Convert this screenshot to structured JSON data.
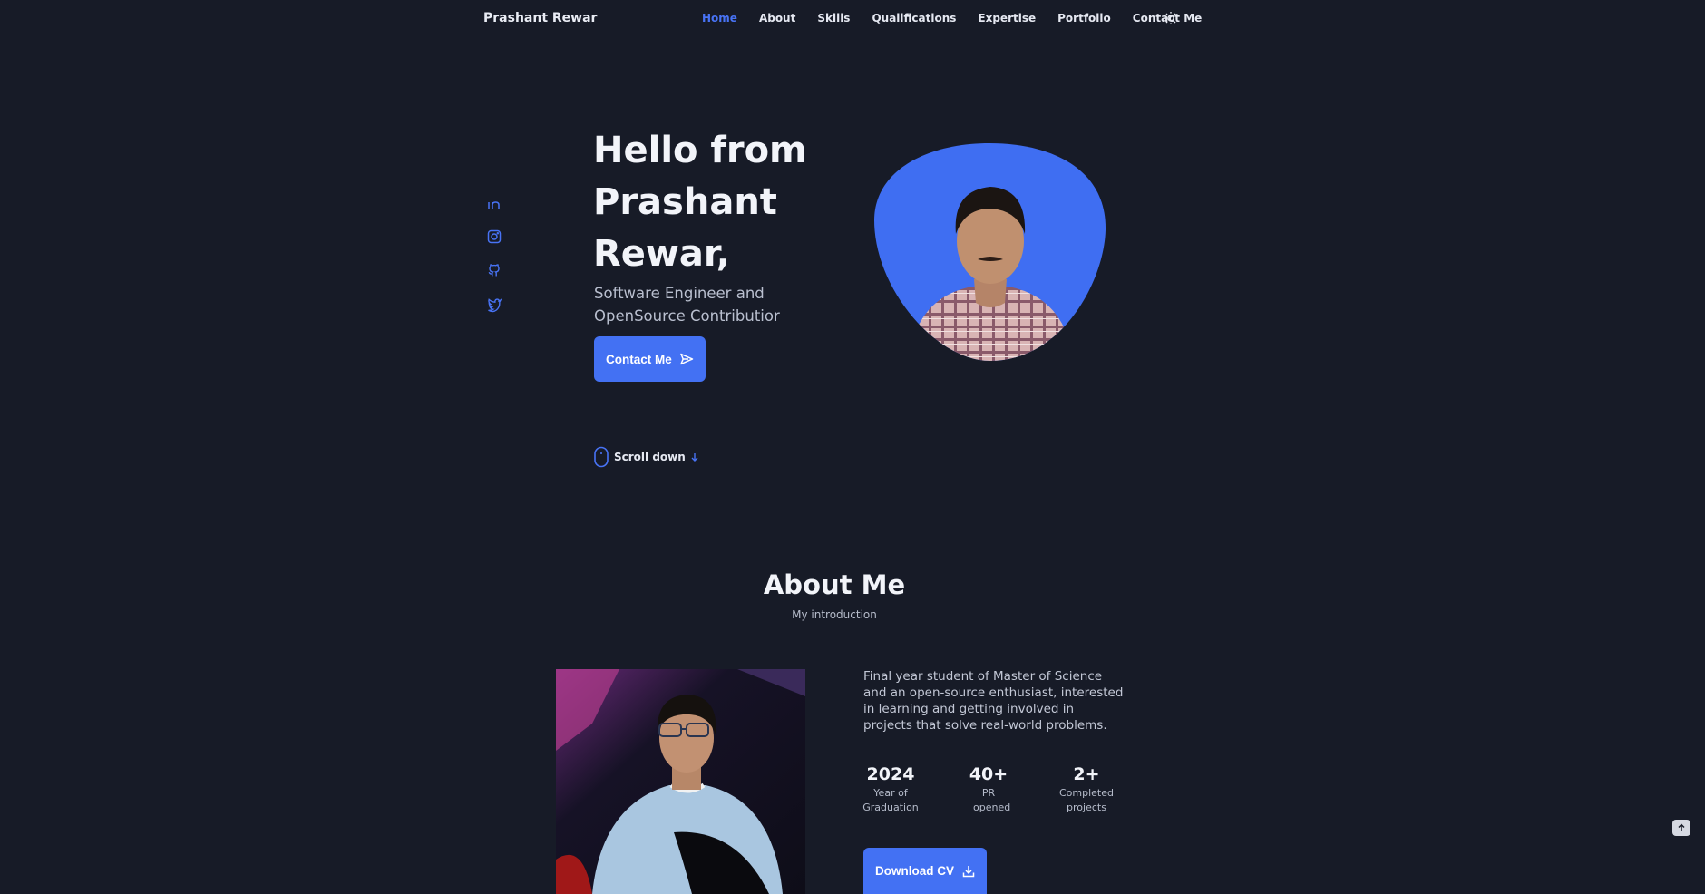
{
  "header": {
    "logo": "Prashant Rewar",
    "nav": [
      {
        "label": "Home",
        "active": true
      },
      {
        "label": "About"
      },
      {
        "label": "Skills"
      },
      {
        "label": "Qualifications"
      },
      {
        "label": "Expertise"
      },
      {
        "label": "Portfolio"
      },
      {
        "label": "Contact Me"
      }
    ],
    "theme_icon": "sun-icon"
  },
  "social": [
    "linkedin-icon",
    "instagram-icon",
    "github-icon",
    "twitter-icon"
  ],
  "hero": {
    "title": "Hello from Prashant Rewar,",
    "subtitle": "Software Engineer and OpenSource Contributior",
    "button_label": "Contact Me",
    "scroll_label": "Scroll down"
  },
  "about": {
    "title": "About Me",
    "subtitle": "My introduction",
    "description": "Final year student of Master of Science and an open-source enthusiast, interested in learning and getting involved in projects that solve real-world problems.",
    "stats": [
      {
        "value": "2024",
        "label": "Year of Graduation"
      },
      {
        "value": "40+",
        "label": "PR opened"
      },
      {
        "value": "2+",
        "label": "Completed projects"
      }
    ],
    "cv_button": "Download CV"
  },
  "colors": {
    "accent": "#4371f3",
    "background": "#171b27"
  }
}
